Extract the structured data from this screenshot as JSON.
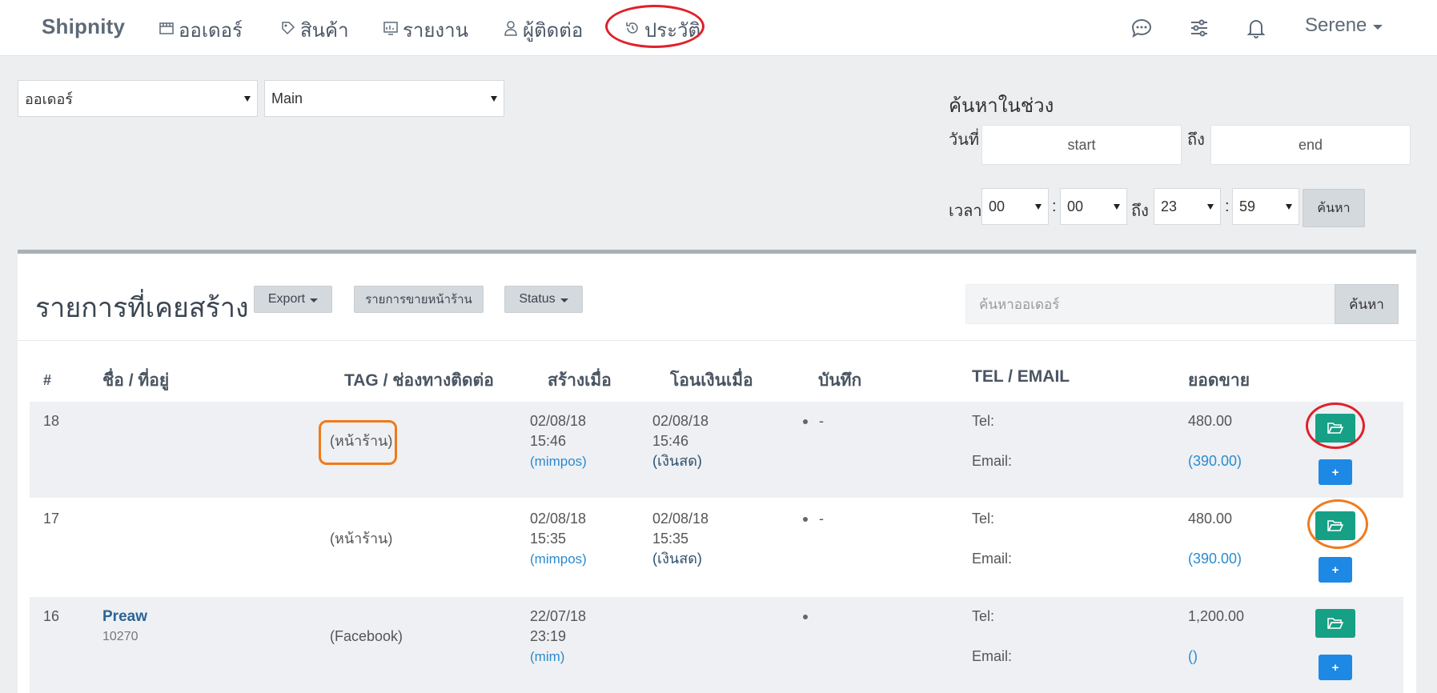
{
  "nav": {
    "brand": "Shipnity",
    "items": [
      {
        "label": "ออเดอร์",
        "icon": "store-icon"
      },
      {
        "label": "สินค้า",
        "icon": "tag-icon"
      },
      {
        "label": "รายงาน",
        "icon": "report-icon"
      },
      {
        "label": "ผู้ติดต่อ",
        "icon": "user-icon"
      },
      {
        "label": "ประวัติ",
        "icon": "history-icon"
      }
    ],
    "right_icons": [
      "chat-icon",
      "sliders-icon",
      "bell-icon"
    ],
    "user": "Serene"
  },
  "filters": {
    "type_select": "ออเดอร์",
    "store_select": "Main",
    "range_title": "ค้นหาในช่วง",
    "date_label": "วันที่",
    "to_label": "ถึง",
    "start_placeholder": "start",
    "end_placeholder": "end",
    "time_label": "เวลา",
    "time_from_h": "00",
    "time_from_m": "00",
    "time_to_h": "23",
    "time_to_m": "59",
    "colon": ":",
    "search_button": "ค้นหา"
  },
  "panel": {
    "title": "รายการที่เคยสร้าง",
    "export_button": "Export",
    "pos_button": "รายการขายหน้าร้าน",
    "status_button": "Status",
    "search_placeholder": "ค้นหาออเดอร์",
    "search_button": "ค้นหา",
    "columns": [
      "#",
      "ชื่อ / ที่อยู่",
      "TAG / ช่องทางติดต่อ",
      "สร้างเมื่อ",
      "โอนเงินเมื่อ",
      "บันทึก",
      "TEL / EMAIL",
      "ยอดขาย"
    ],
    "rows": [
      {
        "id": "18",
        "name": "",
        "address": "",
        "tag": "(หน้าร้าน)",
        "created_date": "02/08/18",
        "created_time": "15:46",
        "created_by": "(mimpos)",
        "paid_date": "02/08/18",
        "paid_time": "15:46",
        "paid_method": "(เงินสด)",
        "note": "-",
        "tel": "Tel:",
        "email": "Email:",
        "total": "480.00",
        "sub": "(390.00)",
        "add": "+"
      },
      {
        "id": "17",
        "name": "",
        "address": "",
        "tag": "(หน้าร้าน)",
        "created_date": "02/08/18",
        "created_time": "15:35",
        "created_by": "(mimpos)",
        "paid_date": "02/08/18",
        "paid_time": "15:35",
        "paid_method": "(เงินสด)",
        "note": "-",
        "tel": "Tel:",
        "email": "Email:",
        "total": "480.00",
        "sub": "(390.00)",
        "add": "+"
      },
      {
        "id": "16",
        "name": "Preaw",
        "address": "10270",
        "tag": "(Facebook)",
        "created_date": "22/07/18",
        "created_time": "23:19",
        "created_by": "(mim)",
        "paid_date": "",
        "paid_time": "",
        "paid_method": "",
        "note": "",
        "tel": "Tel:",
        "email": "Email:",
        "total": "1,200.00",
        "sub": "()",
        "add": "+"
      }
    ]
  },
  "colors": {
    "open_button": "#16a085",
    "add_button": "#1e88e5",
    "annotation_red": "#e0202a",
    "annotation_orange": "#f07a1a"
  }
}
